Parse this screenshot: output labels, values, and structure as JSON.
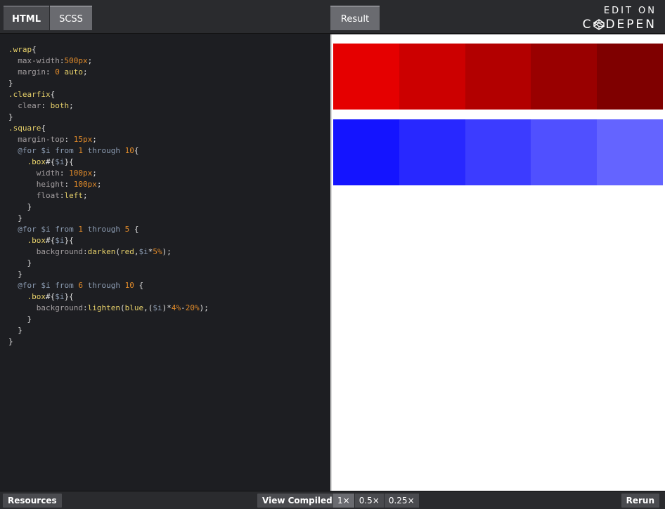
{
  "editor": {
    "tabs": [
      "HTML",
      "SCSS"
    ],
    "active_tab": "SCSS",
    "code_lines": [
      ".wrap{",
      "  max-width:500px;",
      "  margin: 0 auto;",
      "}",
      ".clearfix{",
      "  clear: both;",
      "}",
      ".square{",
      "  margin-top: 15px;",
      "  @for $i from 1 through 10{",
      "    .box#{$i}{",
      "      width: 100px;",
      "      height: 100px;",
      "      float:left;",
      "    }",
      "  }",
      "  @for $i from 1 through 5 {",
      "    .box#{$i}{",
      "      background:darken(red,$i*5%);",
      "    }",
      "  }",
      "  @for $i from 6 through 10 {",
      "    .box#{$i}{",
      "      background:lighten(blue,($i)*4%-20%);",
      "    }",
      "  }",
      "}"
    ]
  },
  "result": {
    "tab_label": "Result",
    "row1_colors": [
      "#e50000",
      "#cc0000",
      "#b20000",
      "#990000",
      "#7f0000"
    ],
    "row2_colors": [
      "#1414ff",
      "#2828ff",
      "#3c3cff",
      "#5050ff",
      "#6464ff"
    ]
  },
  "branding": {
    "line1": "EDIT ON",
    "line2_prefix": "C",
    "line2_suffix": "DEPEN"
  },
  "footer": {
    "resources_label": "Resources",
    "view_compiled_label": "View Compiled",
    "zoom_options": [
      "1×",
      "0.5×",
      "0.25×"
    ],
    "active_zoom": "1×",
    "rerun_label": "Rerun"
  }
}
